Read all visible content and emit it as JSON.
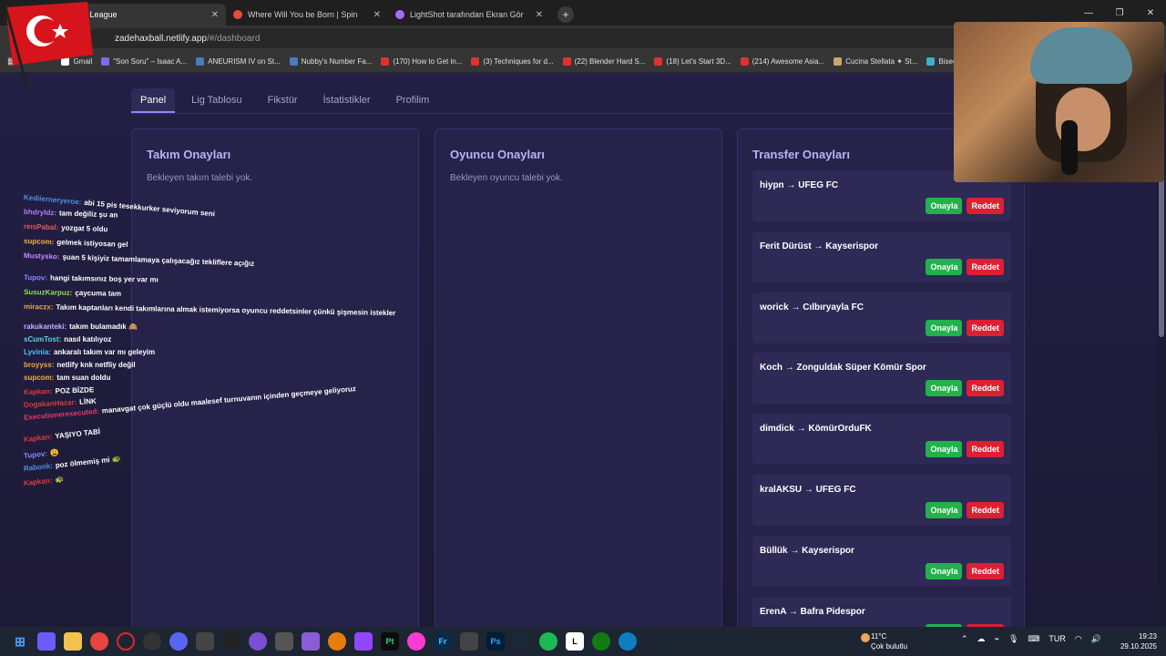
{
  "browser": {
    "tabs": [
      {
        "title": "l League",
        "active": true
      },
      {
        "title": "Where Will You be Born | Spin",
        "active": false
      },
      {
        "title": "LightShot tarafından Ekran Gör",
        "active": false
      }
    ],
    "new_tab": "+",
    "url_host": "zadehaxball.netlify.app",
    "url_path": "/#/dashboard",
    "bookmarks": [
      "Gmail",
      "\"Son Soru\" – Isaac A...",
      "ANEURISM IV on St...",
      "Nubby's Number Fa...",
      "(170) How to Get in...",
      "(3) Techniques for d...",
      "(22) Blender Hard S...",
      "(18) Let's Start 3D...",
      "(214) Awesome Asia...",
      "Cucina Stellata ✦ St...",
      "Bisecti"
    ]
  },
  "nav": {
    "tabs": [
      "Panel",
      "Lig Tablosu",
      "Fikstür",
      "İstatistikler",
      "Profilim"
    ]
  },
  "panels": {
    "team": {
      "title": "Takım Onayları",
      "empty": "Bekleyen takım talebi yok."
    },
    "player": {
      "title": "Oyuncu Onayları",
      "empty": "Bekleyen oyuncu talebi yok."
    },
    "transfer": {
      "title": "Transfer Onayları",
      "approve_label": "Onayla",
      "reject_label": "Reddet",
      "items": [
        "hiypn → UFEG FC",
        "Ferit Dürüst → Kayserispor",
        "worick → Cılbıryayla FC",
        "Koch → Zonguldak Süper Kömür Spor",
        "dimdick → KömürOrduFK",
        "kralAKSU → UFEG FC",
        "Büllük → Kayserispor",
        "ErenA → Bafra Pidespor"
      ]
    }
  },
  "chat": [
    {
      "user": "Kediierneryeroe:",
      "msg": "abi 15 pis tesekkurker seviyorum seni",
      "color": "#4a90e2"
    },
    {
      "user": "bhdryldz:",
      "msg": "tam değiliz şu an",
      "color": "#b37cff"
    },
    {
      "user": "reisPabal:",
      "msg": "yozgat 5 oldu",
      "color": "#e05a5a"
    },
    {
      "user": "supcom:",
      "msg": "gelmek istiyosan gel",
      "color": "#f0b23d"
    },
    {
      "user": "Mustysko:",
      "msg": "şuan 5 kişiyiz tamamlamaya çalışacağız tekliflere açığız",
      "color": "#c98aff"
    },
    {
      "user": "Tupov:",
      "msg": "hangi takımsınız boş yer var mı",
      "color": "#7d8cff"
    },
    {
      "user": "SusuzKarpuz:",
      "msg": "çaycuma tam",
      "color": "#8be04a"
    },
    {
      "user": "miraczx:",
      "msg": "Takım kaptanları kendi takımlarına almak istemiyorsa oyuncu reddetsinler çünkü şişmesin istekler",
      "color": "#e9a64b"
    },
    {
      "user": "rakukanteki:",
      "msg": "takım bulamadık 🙈",
      "color": "#c7b0ff"
    },
    {
      "user": "sCumTost:",
      "msg": "nasıl katılıyoz",
      "color": "#5ad1e0"
    },
    {
      "user": "Lyvinia:",
      "msg": "ankaralı takım var mı geleyim",
      "color": "#4fc3f7"
    },
    {
      "user": "broyyss:",
      "msg": "netlify knk netfliy değil",
      "color": "#f4a742"
    },
    {
      "user": "supcom:",
      "msg": "tam suan doldu",
      "color": "#f0b23d"
    },
    {
      "user": "Kapkan:",
      "msg": "POZ BİZDE",
      "color": "#e03a3a"
    },
    {
      "user": "DogakanHazar:",
      "msg": "LİNK",
      "color": "#e03a3a"
    },
    {
      "user": "Executionerexecuted:",
      "msg": "manavgat çok güçlü oldu maalesef turnuvanın içinden geçmeye geliyoruz",
      "color": "#e23a6d"
    },
    {
      "user": "Kapkan:",
      "msg": "YAŞIYO TABİ",
      "color": "#e03a3a"
    },
    {
      "user": "Tupov:",
      "msg": "😩",
      "color": "#7d8cff"
    },
    {
      "user": "Rabonk:",
      "msg": "poz ölmemiş mi 🐢",
      "color": "#4a90e2"
    },
    {
      "user": "Kapkan:",
      "msg": "🐢",
      "color": "#e03a3a"
    }
  ],
  "taskbar": {
    "weather_temp": "11°C",
    "weather_desc": "Çok bulutlu",
    "lang": "TUR",
    "time": "19:23",
    "date": "29.10.2025"
  }
}
